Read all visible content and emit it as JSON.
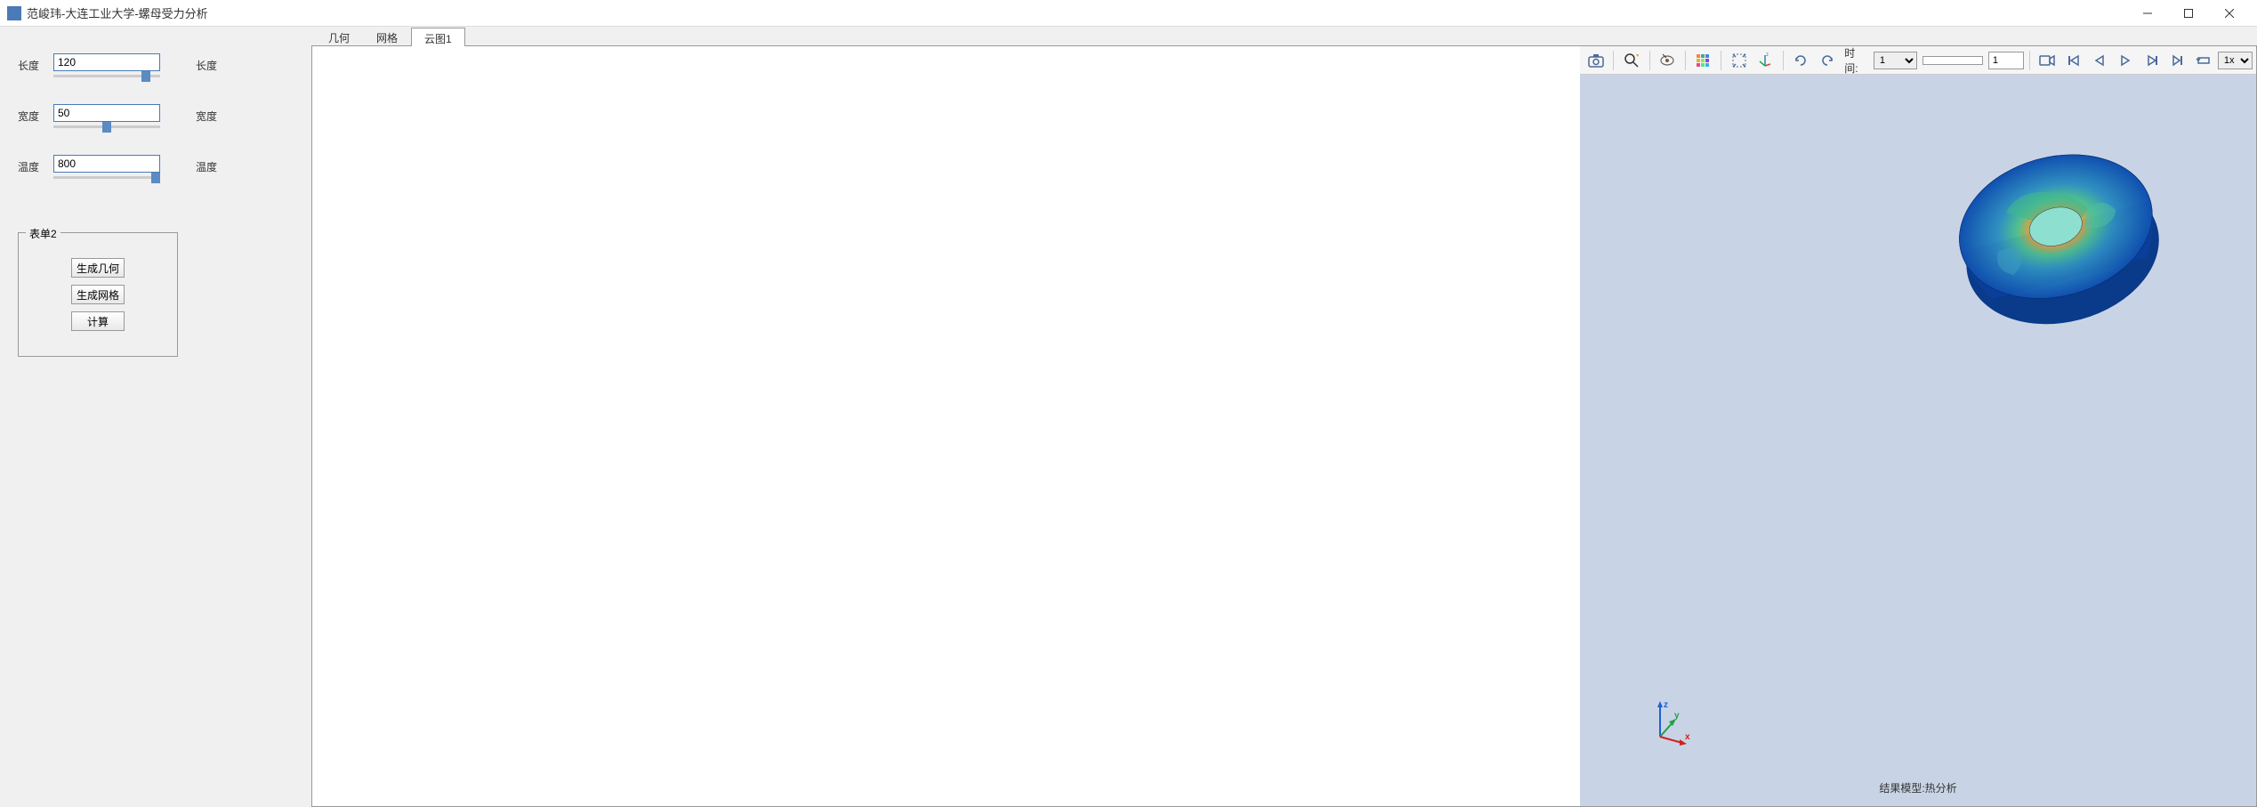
{
  "window": {
    "title": "范峻玮-大连工业大学-螺母受力分析"
  },
  "params": {
    "length": {
      "label": "长度",
      "value": "120",
      "right_label": "长度"
    },
    "width": {
      "label": "宽度",
      "value": "50",
      "right_label": "宽度"
    },
    "temperature": {
      "label": "温度",
      "value": "800",
      "right_label": "温度"
    }
  },
  "form": {
    "title": "表单2",
    "btn_geometry": "生成几何",
    "btn_mesh": "生成网格",
    "btn_compute": "计算"
  },
  "tabs": {
    "geometry": "几何",
    "mesh": "网格",
    "cloud": "云图1"
  },
  "toolbar": {
    "time_label": "时间:",
    "time_value": "1",
    "frame_value": "1",
    "speed": "1x"
  },
  "viewport": {
    "result_label": "结果模型:热分析"
  }
}
